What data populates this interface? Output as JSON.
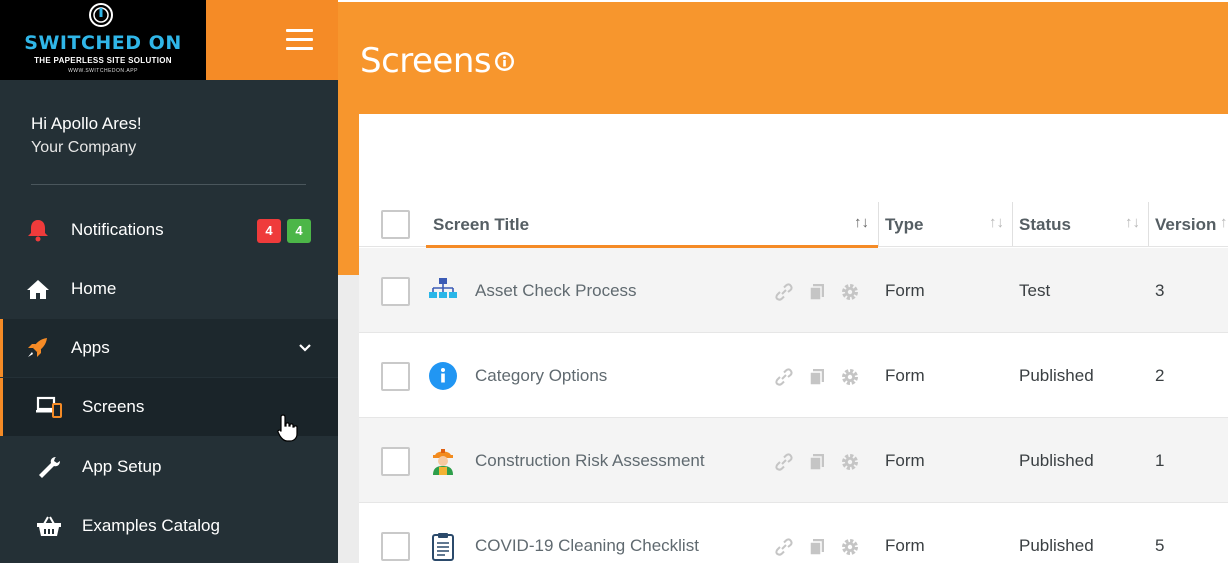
{
  "brand": {
    "name": "SWITCHED ON",
    "tagline": "THE PAPERLESS SITE SOLUTION",
    "url": "WWW.SWITCHEDON.APP"
  },
  "user": {
    "greeting": "Hi Apollo Ares!",
    "company": "Your Company"
  },
  "nav": {
    "notifications": {
      "label": "Notifications",
      "badge_red": "4",
      "badge_green": "4"
    },
    "home": {
      "label": "Home"
    },
    "apps": {
      "label": "Apps"
    },
    "screens": {
      "label": "Screens"
    },
    "app_setup": {
      "label": "App Setup"
    },
    "examples": {
      "label": "Examples Catalog"
    }
  },
  "page": {
    "title": "Screens"
  },
  "table": {
    "columns": {
      "title": "Screen Title",
      "type": "Type",
      "status": "Status",
      "version": "Version"
    },
    "rows": [
      {
        "title": "Asset Check Process",
        "type": "Form",
        "status": "Test",
        "version": "3",
        "icon": "org-chart-icon"
      },
      {
        "title": "Category Options",
        "type": "Form",
        "status": "Published",
        "version": "2",
        "icon": "info-circle-icon"
      },
      {
        "title": "Construction Risk Assessment",
        "type": "Form",
        "status": "Published",
        "version": "1",
        "icon": "construction-worker-icon"
      },
      {
        "title": "COVID-19 Cleaning Checklist",
        "type": "Form",
        "status": "Published",
        "version": "5",
        "icon": "clipboard-icon"
      }
    ]
  },
  "colors": {
    "accent": "#f58b26",
    "header": "#f7962d",
    "sidebar": "#243036",
    "brand_blue": "#30b6e8",
    "badge_red": "#ef3b3b",
    "badge_green": "#4cb648"
  }
}
